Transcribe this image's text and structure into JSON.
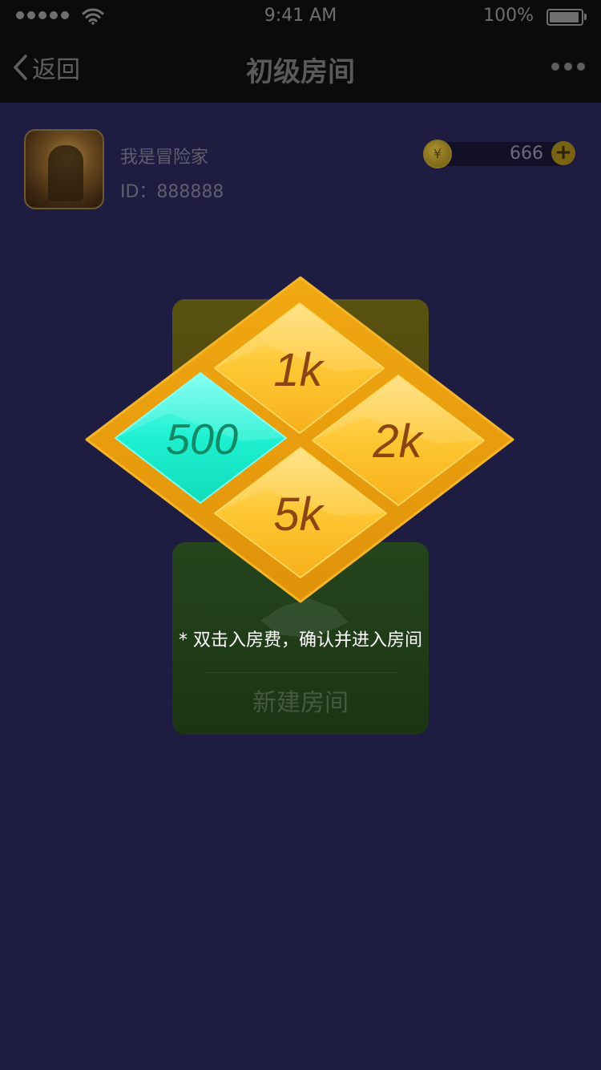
{
  "status_bar": {
    "time": "9:41 AM",
    "battery": "100%",
    "battery_level": 1.0
  },
  "nav": {
    "back_label": "返回",
    "title": "初级房间"
  },
  "profile": {
    "name": "我是冒险家",
    "id_label": "ID：888888",
    "coins": "666",
    "coin_symbol": "¥"
  },
  "room_card": {
    "create_label": "新建房间"
  },
  "fee_selector": {
    "options": [
      {
        "label": "1k",
        "selected": false
      },
      {
        "label": "500",
        "selected": true
      },
      {
        "label": "2k",
        "selected": false
      },
      {
        "label": "5k",
        "selected": false
      }
    ],
    "hint": "* 双击入房费，确认并进入房间"
  },
  "colors": {
    "frame_gold": "#e69c0b",
    "tile_gold": "#fdc530",
    "tile_selected": "#19efce",
    "label_brown": "#8a4510",
    "label_green": "#128a63"
  }
}
